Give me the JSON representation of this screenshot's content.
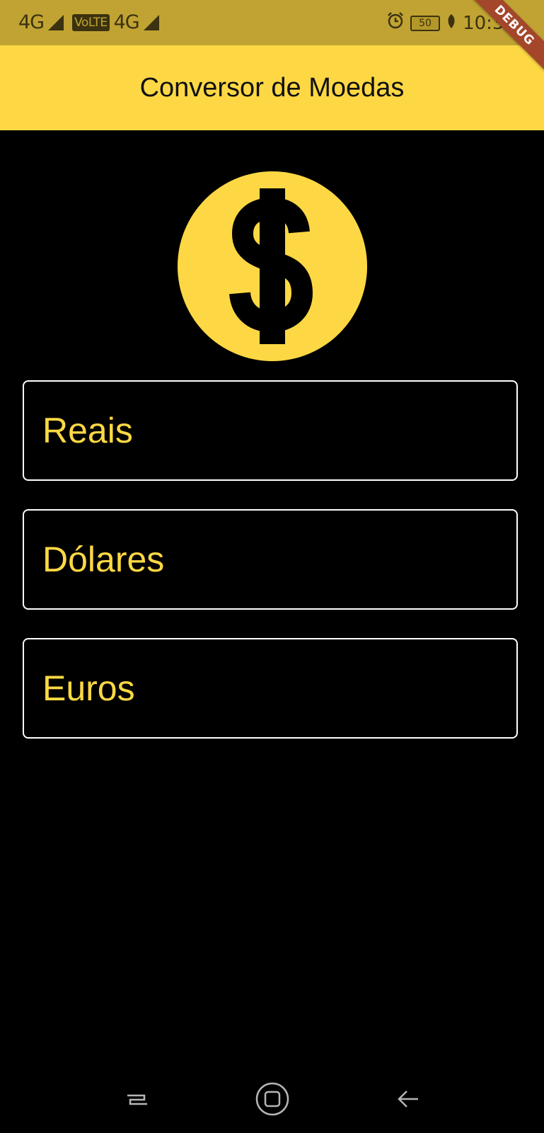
{
  "status_bar": {
    "network_1": "4G",
    "volte": "VoLTE",
    "network_2": "4G",
    "battery": "50",
    "time": "10:34",
    "debug_label": "DEBUG"
  },
  "app_bar": {
    "title": "Conversor de Moedas"
  },
  "fields": [
    {
      "label": "Reais"
    },
    {
      "label": "Dólares"
    },
    {
      "label": "Euros"
    }
  ],
  "colors": {
    "accent": "#fdd844",
    "background": "#000000",
    "status_bar": "#c0a332",
    "debug_ribbon": "#a3462a"
  },
  "icons": {
    "hero": "dollar-coin-icon",
    "nav": [
      "recent-apps-icon",
      "home-icon",
      "back-icon"
    ]
  }
}
